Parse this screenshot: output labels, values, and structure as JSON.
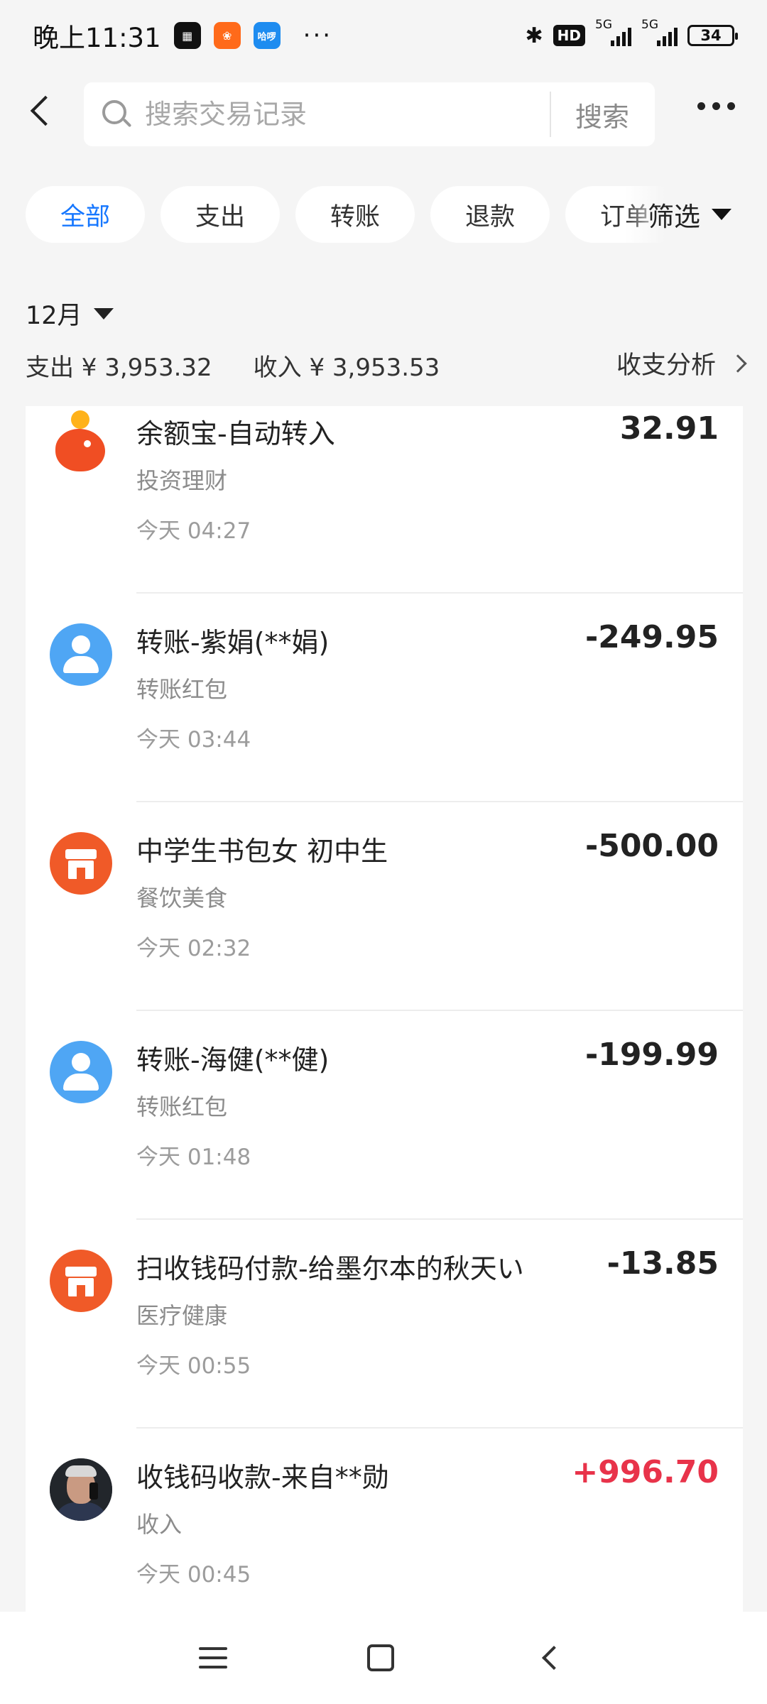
{
  "status_bar": {
    "time": "晚上11:31",
    "app_icons": [
      "game-app-icon",
      "social-app-icon",
      "haluo-app-icon"
    ],
    "haluo_label": "哈啰",
    "more": "···",
    "network_hd": "HD",
    "network_5g_1": "5G",
    "network_5g_2": "5G",
    "battery": "34"
  },
  "header": {
    "search_placeholder": "搜索交易记录",
    "search_button": "搜索"
  },
  "filters": {
    "chips": [
      "全部",
      "支出",
      "转账",
      "退款",
      "订单"
    ],
    "active_index": 0,
    "filter_label": "筛选",
    "active_color": "#1677ff"
  },
  "summary": {
    "month": "12月",
    "expense": "支出 ¥ 3,953.32",
    "income": "收入 ¥ 3,953.53",
    "analysis": "收支分析"
  },
  "transactions": [
    {
      "title": "余额宝-自动转入",
      "category": "投资理财",
      "time": "今天 04:27",
      "amount": "32.91",
      "icon": "yuebao-icon"
    },
    {
      "title": "转账-紫娟(**娟)",
      "category": "转账红包",
      "time": "今天 03:44",
      "amount": "-249.95",
      "icon": "person-icon"
    },
    {
      "title": "中学生书包女 初中生",
      "category": "餐饮美食",
      "time": "今天 02:32",
      "amount": "-500.00",
      "icon": "shop-icon"
    },
    {
      "title": "转账-海健(**健)",
      "category": "转账红包",
      "time": "今天 01:48",
      "amount": "-199.99",
      "icon": "person-icon"
    },
    {
      "title": "扫收钱码付款-给墨尔本的秋天い",
      "category": "医疗健康",
      "time": "今天 00:55",
      "amount": "-13.85",
      "icon": "shop-icon"
    },
    {
      "title": "收钱码收款-来自**勋",
      "category": "收入",
      "time": "今天 00:45",
      "amount": "+996.70",
      "icon": "user-photo-avatar"
    }
  ],
  "colors": {
    "income": "#e8334a",
    "background": "#f5f5f5",
    "person_avatar": "#4fa6f4",
    "shop_avatar": "#f05a28"
  }
}
